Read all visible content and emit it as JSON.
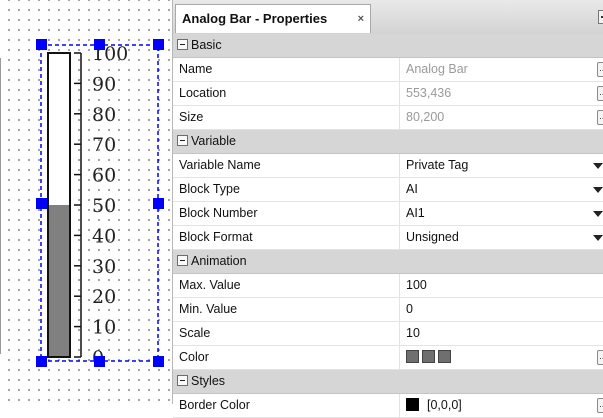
{
  "panel": {
    "title": "Analog Bar - Properties",
    "close_glyph": "×"
  },
  "bar": {
    "scale_labels": [
      "100",
      "90",
      "80",
      "70",
      "60",
      "50",
      "40",
      "30",
      "20",
      "10",
      "0"
    ],
    "scale_max": 100,
    "scale_min": 0,
    "fill_value": 50,
    "fill_color": "#808080",
    "selection_color": "#0000ff"
  },
  "categories": {
    "basic": {
      "label": "Basic",
      "rows": [
        {
          "name": "Name",
          "value": "Analog Bar"
        },
        {
          "name": "Location",
          "value": "553,436"
        },
        {
          "name": "Size",
          "value": "80,200"
        }
      ]
    },
    "variable": {
      "label": "Variable",
      "rows": [
        {
          "name": "Variable Name",
          "value": "Private Tag"
        },
        {
          "name": "Block Type",
          "value": "AI"
        },
        {
          "name": "Block Number",
          "value": "AI1"
        },
        {
          "name": "Block Format",
          "value": "Unsigned"
        }
      ]
    },
    "animation": {
      "label": "Animation",
      "rows": [
        {
          "name": "Max. Value",
          "value": "100"
        },
        {
          "name": "Min. Value",
          "value": "0"
        },
        {
          "name": "Scale",
          "value": "10"
        },
        {
          "name": "Color",
          "value": ""
        }
      ]
    },
    "styles": {
      "label": "Styles",
      "rows": [
        {
          "name": "Border Color",
          "value": "[0,0,0]"
        }
      ]
    }
  },
  "ellipsis_glyph": "..."
}
